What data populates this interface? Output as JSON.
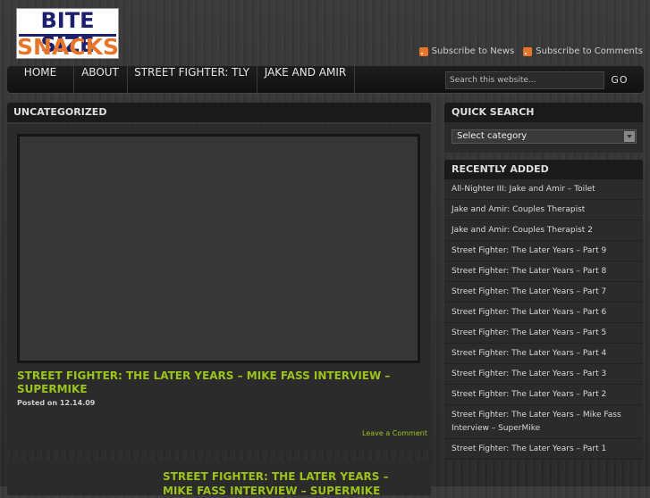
{
  "logo": {
    "line1": "BITE SIZE",
    "line2": "SNACKS"
  },
  "subscribe": [
    {
      "label": "Subscribe to News",
      "icon": "rss-icon"
    },
    {
      "label": "Subscribe to Comments",
      "icon": "rss-icon"
    }
  ],
  "nav": {
    "items": [
      "HOME",
      "ABOUT",
      "STREET FIGHTER: TLY",
      "JAKE AND AMIR"
    ]
  },
  "search": {
    "placeholder": "Search this website...",
    "button": "GO"
  },
  "main": {
    "heading": "UNCATEGORIZED",
    "posts": [
      {
        "title": "STREET FIGHTER: THE LATER YEARS – MIKE FASS INTERVIEW – SUPERMIKE",
        "posted_label": "Posted on",
        "date": "12.14.09",
        "comment_link": "Leave a Comment"
      },
      {
        "title": "STREET FIGHTER: THE LATER YEARS – MIKE FASS INTERVIEW – SUPERMIKE"
      }
    ]
  },
  "sidebar": {
    "quick_search": {
      "heading": "QUICK SEARCH",
      "select_value": "Select category"
    },
    "recently_added": {
      "heading": "RECENTLY ADDED",
      "items": [
        "All-Nighter III: Jake and Amir – Toilet",
        "Jake and Amir: Couples Therapist",
        "Jake and Amir: Couples Therapist 2",
        "Street Fighter: The Later Years – Part 9",
        "Street Fighter: The Later Years – Part 8",
        "Street Fighter: The Later Years – Part 7",
        "Street Fighter: The Later Years – Part 6",
        "Street Fighter: The Later Years – Part 5",
        "Street Fighter: The Later Years – Part 4",
        "Street Fighter: The Later Years – Part 3",
        "Street Fighter: The Later Years – Part 2",
        "Street Fighter: The Later Years – Mike Fass Interview – SuperMike",
        "Street Fighter: The Later Years – Part 1"
      ]
    }
  },
  "colors": {
    "accent_green": "#9cc31a",
    "logo_navy": "#1c1e6e",
    "logo_orange": "#e8762a",
    "rss_orange": "#e8762a"
  }
}
